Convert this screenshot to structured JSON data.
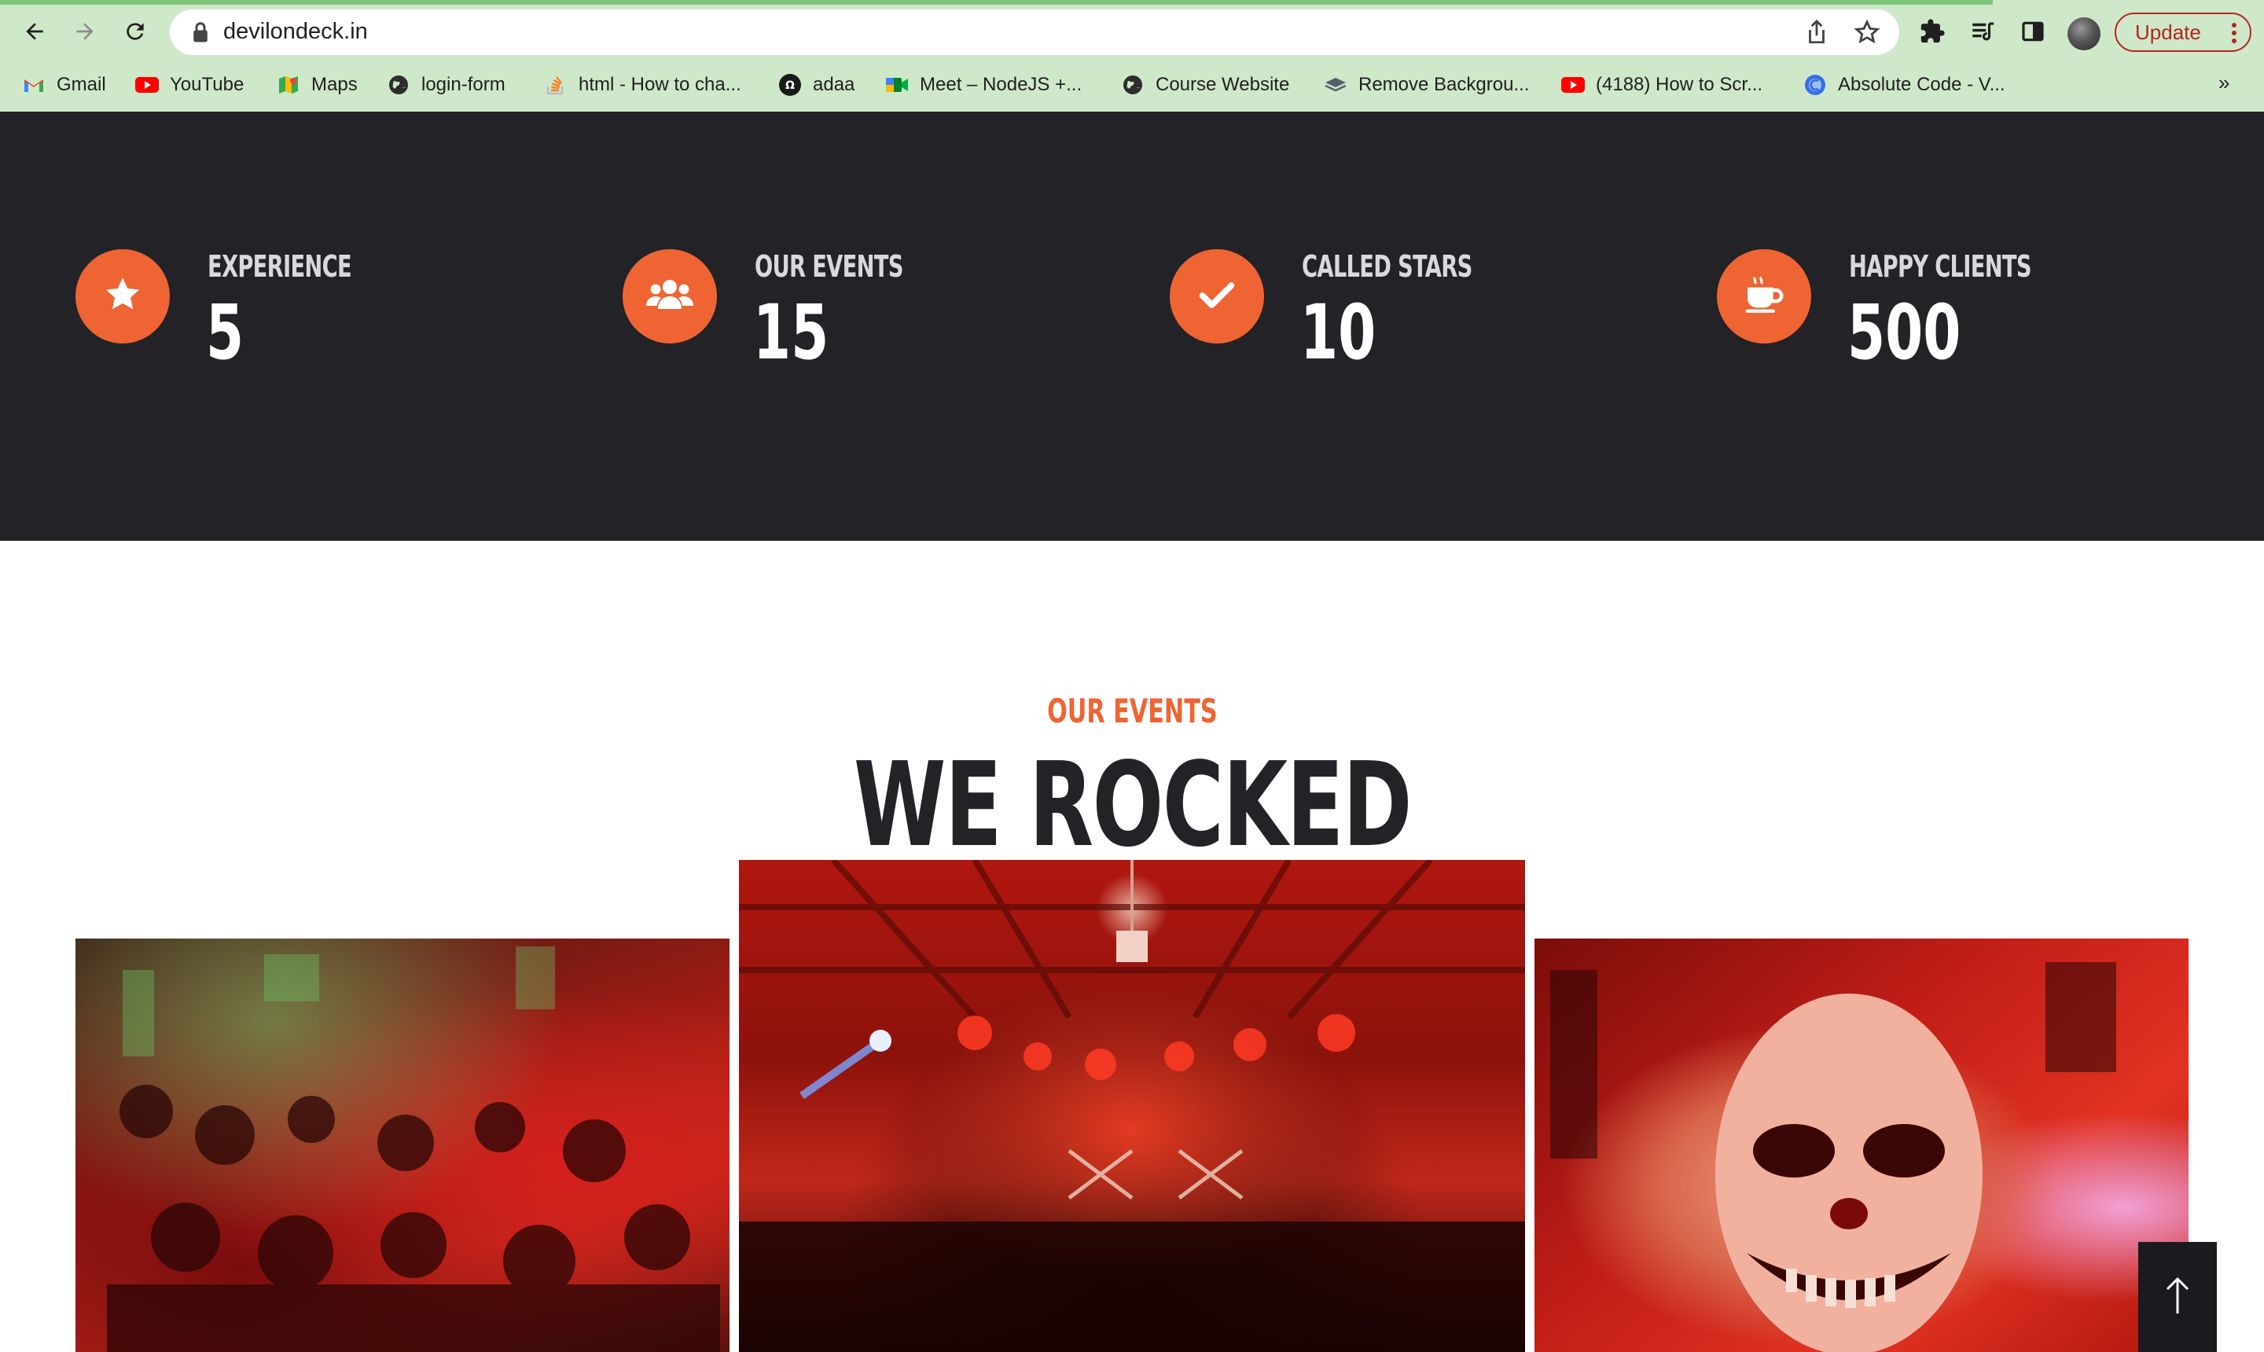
{
  "browser": {
    "url": "devilondeck.in",
    "update_label": "Update",
    "icons": [
      "back-arrow-icon",
      "forward-arrow-icon",
      "reload-icon",
      "lock-icon",
      "share-icon",
      "star-icon",
      "extensions-icon",
      "reading-list-icon",
      "side-panel-icon",
      "avatar",
      "menu-dots-icon"
    ],
    "bookmarks": [
      {
        "label": "Gmail",
        "icon": "gmail-icon"
      },
      {
        "label": "YouTube",
        "icon": "youtube-icon"
      },
      {
        "label": "Maps",
        "icon": "maps-icon"
      },
      {
        "label": "login-form",
        "icon": "globe-icon"
      },
      {
        "label": "html - How to cha...",
        "icon": "stackoverflow-icon"
      },
      {
        "label": "adaa",
        "icon": "adaa-icon"
      },
      {
        "label": "Meet – NodeJS +...",
        "icon": "meet-icon"
      },
      {
        "label": "Course Website",
        "icon": "globe-icon"
      },
      {
        "label": "Remove Backgrou...",
        "icon": "removebg-icon"
      },
      {
        "label": "(4188) How to Scr...",
        "icon": "youtube-icon"
      },
      {
        "label": "Absolute Code - V...",
        "icon": "absolute-code-icon"
      }
    ],
    "more_label": "»"
  },
  "stats": [
    {
      "label": "EXPERIENCE",
      "value": "5",
      "icon": "star-icon"
    },
    {
      "label": "OUR EVENTS",
      "value": "15",
      "icon": "users-icon"
    },
    {
      "label": "CALLED STARS",
      "value": "10",
      "icon": "check-icon"
    },
    {
      "label": "HAPPY CLIENTS",
      "value": "500",
      "icon": "coffee-icon"
    }
  ],
  "events": {
    "label": "OUR EVENTS",
    "title": "WE ROCKED"
  },
  "colors": {
    "accent": "#ee6433",
    "dark_band": "#222227",
    "chrome_bg": "#cfe8c9",
    "update_red": "#b3261e"
  }
}
